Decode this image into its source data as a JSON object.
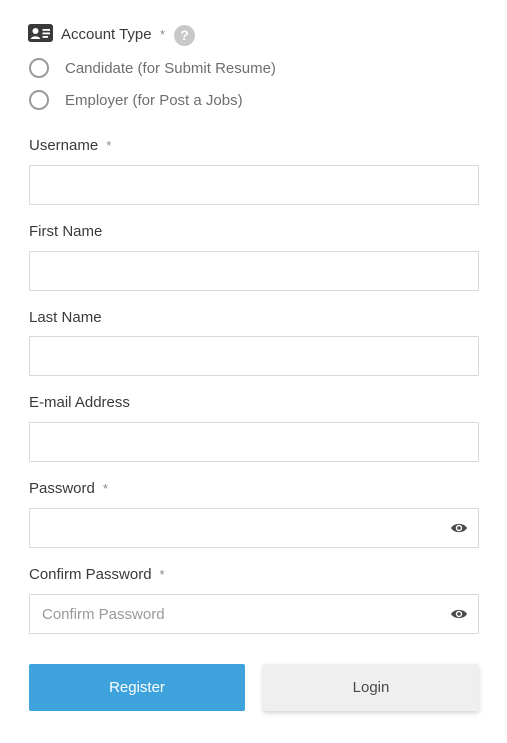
{
  "account_type": {
    "label": "Account Type",
    "required_mark": "*",
    "help_icon": "question-circle-icon",
    "help_glyph": "?",
    "header_icon": "id-card-icon",
    "options": [
      {
        "label": "Candidate (for Submit Resume)",
        "selected": false
      },
      {
        "label": "Employer (for Post a Jobs)",
        "selected": false
      }
    ]
  },
  "fields": {
    "username": {
      "label": "Username",
      "required_mark": "*",
      "value": "",
      "placeholder": ""
    },
    "first_name": {
      "label": "First Name",
      "value": "",
      "placeholder": ""
    },
    "last_name": {
      "label": "Last Name",
      "value": "",
      "placeholder": ""
    },
    "email": {
      "label": "E-mail Address",
      "value": "",
      "placeholder": ""
    },
    "password": {
      "label": "Password",
      "required_mark": "*",
      "value": "",
      "placeholder": "",
      "toggle_icon": "eye-icon"
    },
    "confirm_password": {
      "label": "Confirm Password",
      "required_mark": "*",
      "value": "",
      "placeholder": "Confirm Password",
      "toggle_icon": "eye-icon"
    }
  },
  "buttons": {
    "register": "Register",
    "login": "Login"
  },
  "colors": {
    "primary_button": "#3ea2dc",
    "secondary_button": "#efefef",
    "input_border": "#d9d9d9",
    "text": "#3a3a3a",
    "muted_text": "#6e6e6e"
  }
}
